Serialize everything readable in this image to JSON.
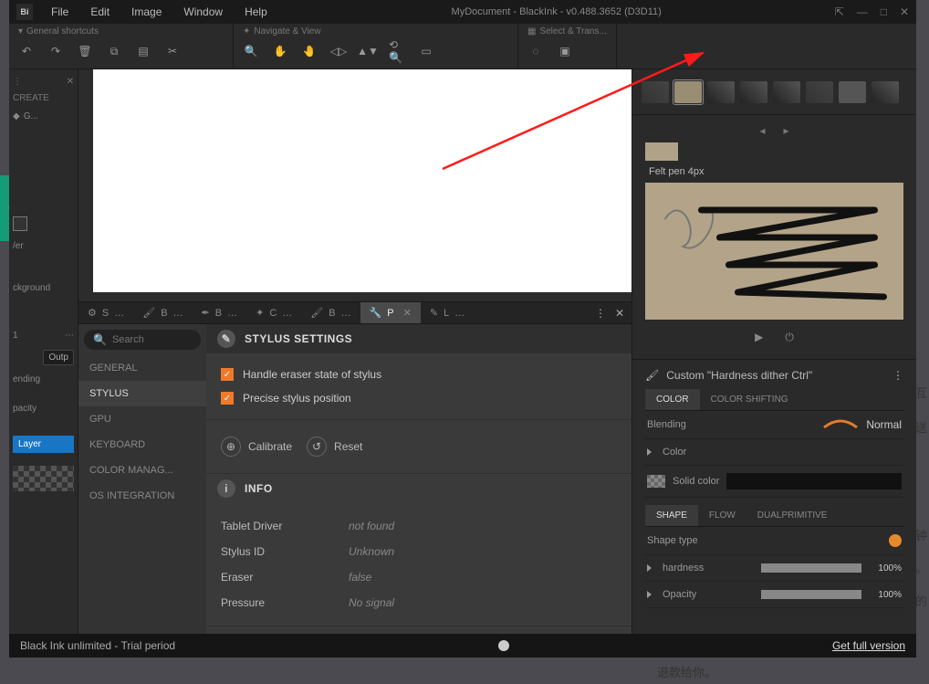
{
  "title": "MyDocument - BlackInk  - v0.488.3652 (D3D11)",
  "menubar": [
    "File",
    "Edit",
    "Image",
    "Window",
    "Help"
  ],
  "toolbars": {
    "general": "General shortcuts",
    "navigate": "Navigate & View",
    "select": "Select & Trans..."
  },
  "left": {
    "create": "CREATE",
    "g": "G...",
    "outp": "Outp",
    "background": "ckground",
    "blending": "ending",
    "opacity": "pacity",
    "layer": "Layer",
    "output_band": "Output",
    "num": "1",
    "ver": "/er"
  },
  "tabs": {
    "items": [
      "S",
      "B",
      "B",
      "C",
      "B",
      "P",
      "L"
    ],
    "activeIndex": 5
  },
  "settings": {
    "search_placeholder": "Search",
    "nav": [
      "GENERAL",
      "STYLUS",
      "GPU",
      "KEYBOARD",
      "COLOR MANAG...",
      "OS INTEGRATION"
    ],
    "activeNav": 1,
    "headers": {
      "stylus": "STYLUS SETTINGS",
      "info": "INFO"
    },
    "checks": {
      "eraser": "Handle eraser state of stylus",
      "precise": "Precise stylus position"
    },
    "buttons": {
      "calibrate": "Calibrate",
      "reset": "Reset"
    },
    "info": {
      "tablet_driver_label": "Tablet Driver",
      "tablet_driver_val": "not found",
      "stylus_id_label": "Stylus ID",
      "stylus_id_val": "Unknown",
      "eraser_label": "Eraser",
      "eraser_val": "false",
      "pressure_label": "Pressure",
      "pressure_val": "No signal"
    }
  },
  "right": {
    "brush_name": "Felt pen 4px",
    "ctrl_header": "Custom \"Hardness dither Ctrl\"",
    "color_tabs": [
      "COLOR",
      "COLOR SHIFTING"
    ],
    "blending_label": "Blending",
    "blending_mode": "Normal",
    "color_label": "Color",
    "solid_label": "Solid color",
    "shape_tabs": [
      "SHAPE",
      "FLOW",
      "DUALPRIMITIVE"
    ],
    "shape_type": "Shape type",
    "hardness_label": "hardness",
    "hardness_val": "100%",
    "opacity_label": "Opacity",
    "opacity_val": "100%"
  },
  "status": {
    "left": "Black Ink unlimited - Trial period",
    "right": "Get full version"
  },
  "bg": {
    "t1": "的互",
    "t2": "发送",
    "t3": "分钟",
    "t4": "息。",
    "t5": "用的",
    "t6": "退款给你。"
  }
}
